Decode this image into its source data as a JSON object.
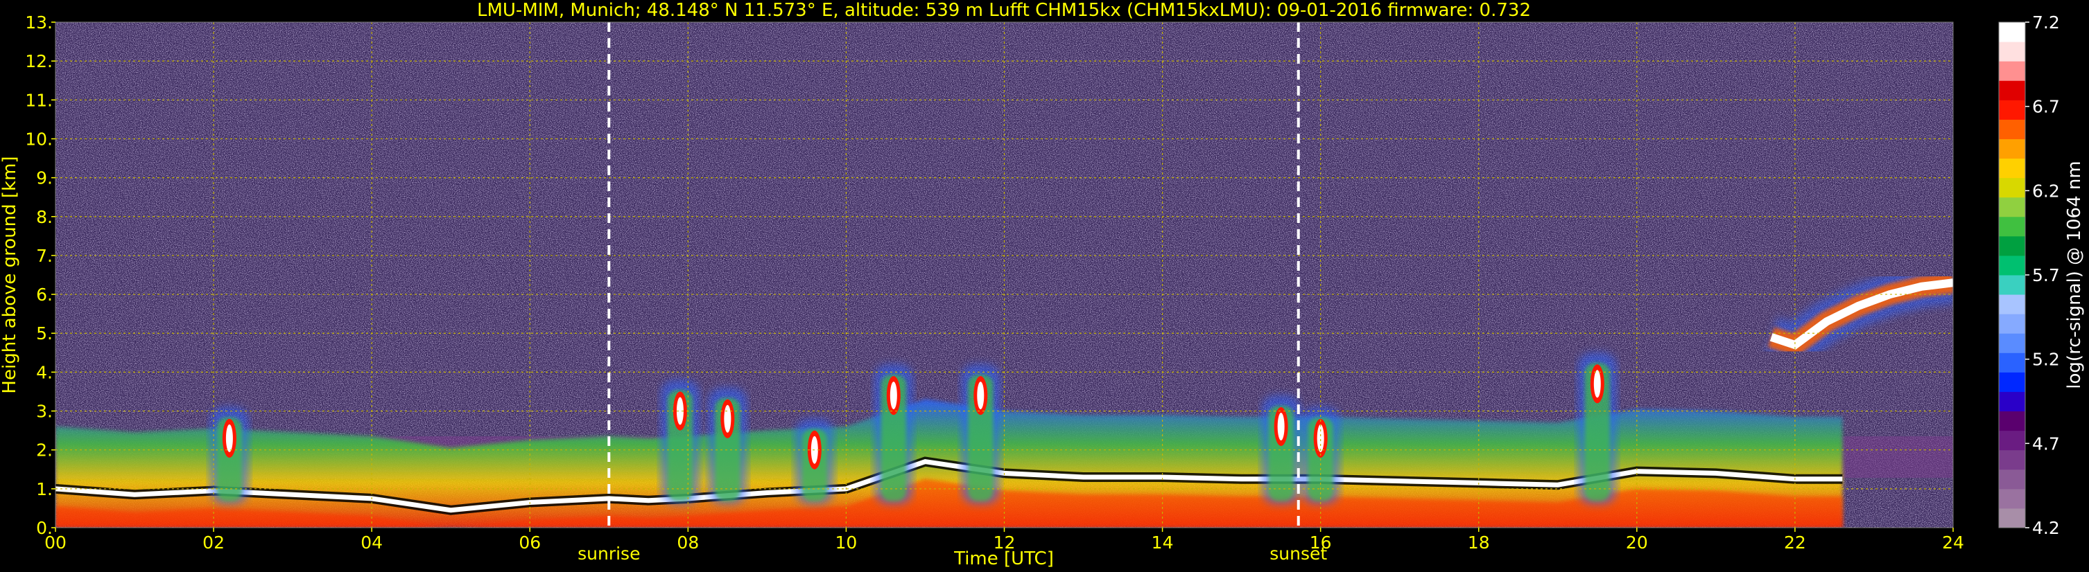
{
  "chart_data": {
    "type": "heatmap",
    "title": "LMU-MIM, Munich; 48.148° N 11.573° E, altitude: 539 m     Lufft CHM15kx (CHM15kxLMU): 09-01-2016     firmware: 0.732",
    "xlabel": "Time [UTC]",
    "ylabel": "Height above ground [km]",
    "xlim": [
      0,
      24
    ],
    "ylim": [
      0,
      13
    ],
    "x_ticks": [
      "00",
      "02",
      "04",
      "06",
      "08",
      "10",
      "12",
      "14",
      "16",
      "18",
      "20",
      "22",
      "24"
    ],
    "y_ticks": [
      "0.",
      "1.",
      "2.",
      "3.",
      "4.",
      "5.",
      "6.",
      "7.",
      "8.",
      "9.",
      "10.",
      "11.",
      "12.",
      "13."
    ],
    "grid": true,
    "events": [
      {
        "label": "sunrise",
        "time": 7.0
      },
      {
        "label": "sunset",
        "time": 15.72
      }
    ],
    "colorbar": {
      "label": "log(rc-signal) @ 1064 nm",
      "range": [
        4.2,
        7.2
      ],
      "ticks": [
        "4.2",
        "4.7",
        "5.2",
        "5.7",
        "6.2",
        "6.7",
        "7.2"
      ],
      "colors": [
        "#a88ea8",
        "#9a72a0",
        "#8a5a96",
        "#7a3c8c",
        "#6a1c82",
        "#5a006e",
        "#2a00c8",
        "#0028ff",
        "#2a62ff",
        "#5a8cff",
        "#86aaff",
        "#a8c4ff",
        "#3ad0c0",
        "#00c070",
        "#00a040",
        "#40c040",
        "#90d040",
        "#d8d800",
        "#ffd000",
        "#ffa000",
        "#ff6000",
        "#ff1800",
        "#e00000",
        "#ff9090",
        "#ffe0e0",
        "#ffffff"
      ]
    },
    "signal_layers": [
      {
        "name": "aerosol layer",
        "x": [
          0.0,
          1.0,
          2.0,
          3.0,
          4.0,
          5.0,
          6.0,
          7.0,
          7.5,
          8.0,
          9.0,
          10.0,
          11.0,
          12.0,
          13.0,
          14.0,
          15.0,
          16.0,
          17.0,
          18.0,
          19.0,
          20.0,
          21.0,
          22.0,
          22.6
        ],
        "y": [
          1.0,
          0.85,
          0.95,
          0.85,
          0.75,
          0.45,
          0.65,
          0.75,
          0.7,
          0.75,
          0.9,
          1.0,
          1.7,
          1.4,
          1.3,
          1.3,
          1.25,
          1.25,
          1.2,
          1.15,
          1.1,
          1.45,
          1.4,
          1.25,
          1.25
        ]
      },
      {
        "name": "upper cloud",
        "x": [
          21.7,
          22.0,
          22.4,
          22.8,
          23.2,
          23.6,
          24.0
        ],
        "y": [
          4.9,
          4.7,
          5.3,
          5.7,
          6.0,
          6.2,
          6.3
        ]
      }
    ],
    "cloud_patches": [
      {
        "x": 2.2,
        "y": 2.3
      },
      {
        "x": 7.9,
        "y": 3.0
      },
      {
        "x": 8.5,
        "y": 2.8
      },
      {
        "x": 9.6,
        "y": 2.0
      },
      {
        "x": 10.6,
        "y": 3.4
      },
      {
        "x": 11.7,
        "y": 3.4
      },
      {
        "x": 15.5,
        "y": 2.6
      },
      {
        "x": 16.0,
        "y": 2.3
      },
      {
        "x": 19.5,
        "y": 3.7
      }
    ]
  }
}
